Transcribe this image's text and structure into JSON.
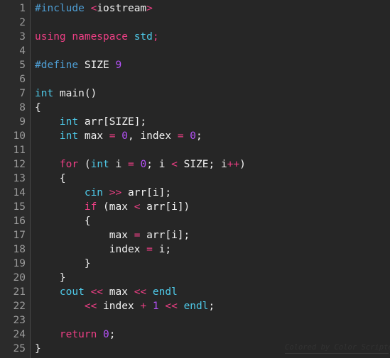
{
  "editor": {
    "language": "C++",
    "background_color": "#262626",
    "gutter_background_color": "#2b2b2b",
    "gutter_divider_color": "#4a4a4a",
    "line_number_color": "#9a9a9a",
    "default_text_color": "#f2f2f2",
    "first_line_number": 1,
    "last_line_number": 25,
    "total_lines": 25
  },
  "palette": {
    "keyword": "#ee3f85",
    "type": "#4ec9e8",
    "preprocessor": "#4e9ed4",
    "builtin": "#4ec9e8",
    "number": "#b451f7",
    "operator": "#ee3f85",
    "plain": "#f2f2f2"
  },
  "gutter": {
    "line_numbers": [
      "1",
      "2",
      "3",
      "4",
      "5",
      "6",
      "7",
      "8",
      "9",
      "10",
      "11",
      "12",
      "13",
      "14",
      "15",
      "16",
      "17",
      "18",
      "19",
      "20",
      "21",
      "22",
      "23",
      "24",
      "25"
    ]
  },
  "code": {
    "plain_text": [
      "#include <iostream>",
      "",
      "using namespace std;",
      "",
      "#define SIZE 9",
      "",
      "int main()",
      "{",
      "    int arr[SIZE];",
      "    int max = 0, index = 0;",
      "",
      "    for (int i = 0; i < SIZE; i++)",
      "    {",
      "        cin >> arr[i];",
      "        if (max < arr[i])",
      "        {",
      "            max = arr[i];",
      "            index = i;",
      "        }",
      "    }",
      "    cout << max << endl",
      "        << index + 1 << endl;",
      "",
      "    return 0;",
      "}"
    ],
    "lines": [
      [
        {
          "t": "#include",
          "c": "pre"
        },
        {
          "t": " ",
          "c": "plain"
        },
        {
          "t": "<",
          "c": "op"
        },
        {
          "t": "iostream",
          "c": "plain"
        },
        {
          "t": ">",
          "c": "op"
        }
      ],
      [],
      [
        {
          "t": "using namespace",
          "c": "keyword"
        },
        {
          "t": " ",
          "c": "plain"
        },
        {
          "t": "std",
          "c": "type"
        },
        {
          "t": ";",
          "c": "op"
        }
      ],
      [],
      [
        {
          "t": "#define",
          "c": "pre"
        },
        {
          "t": " SIZE ",
          "c": "plain"
        },
        {
          "t": "9",
          "c": "number"
        }
      ],
      [],
      [
        {
          "t": "int",
          "c": "type"
        },
        {
          "t": " main()",
          "c": "plain"
        }
      ],
      [
        {
          "t": "{",
          "c": "plain"
        }
      ],
      [
        {
          "t": "    ",
          "c": "plain"
        },
        {
          "t": "int",
          "c": "type"
        },
        {
          "t": " arr[SIZE];",
          "c": "plain"
        }
      ],
      [
        {
          "t": "    ",
          "c": "plain"
        },
        {
          "t": "int",
          "c": "type"
        },
        {
          "t": " max ",
          "c": "plain"
        },
        {
          "t": "=",
          "c": "op"
        },
        {
          "t": " ",
          "c": "plain"
        },
        {
          "t": "0",
          "c": "number"
        },
        {
          "t": ", index ",
          "c": "plain"
        },
        {
          "t": "=",
          "c": "op"
        },
        {
          "t": " ",
          "c": "plain"
        },
        {
          "t": "0",
          "c": "number"
        },
        {
          "t": ";",
          "c": "plain"
        }
      ],
      [],
      [
        {
          "t": "    ",
          "c": "plain"
        },
        {
          "t": "for",
          "c": "keyword"
        },
        {
          "t": " (",
          "c": "plain"
        },
        {
          "t": "int",
          "c": "type"
        },
        {
          "t": " i ",
          "c": "plain"
        },
        {
          "t": "=",
          "c": "op"
        },
        {
          "t": " ",
          "c": "plain"
        },
        {
          "t": "0",
          "c": "number"
        },
        {
          "t": "; i ",
          "c": "plain"
        },
        {
          "t": "<",
          "c": "op"
        },
        {
          "t": " SIZE; i",
          "c": "plain"
        },
        {
          "t": "++",
          "c": "op"
        },
        {
          "t": ")",
          "c": "plain"
        }
      ],
      [
        {
          "t": "    {",
          "c": "plain"
        }
      ],
      [
        {
          "t": "        ",
          "c": "plain"
        },
        {
          "t": "cin",
          "c": "builtin"
        },
        {
          "t": " ",
          "c": "plain"
        },
        {
          "t": ">>",
          "c": "op"
        },
        {
          "t": " arr[i];",
          "c": "plain"
        }
      ],
      [
        {
          "t": "        ",
          "c": "plain"
        },
        {
          "t": "if",
          "c": "keyword"
        },
        {
          "t": " (max ",
          "c": "plain"
        },
        {
          "t": "<",
          "c": "op"
        },
        {
          "t": " arr[i])",
          "c": "plain"
        }
      ],
      [
        {
          "t": "        {",
          "c": "plain"
        }
      ],
      [
        {
          "t": "            max ",
          "c": "plain"
        },
        {
          "t": "=",
          "c": "op"
        },
        {
          "t": " arr[i];",
          "c": "plain"
        }
      ],
      [
        {
          "t": "            index ",
          "c": "plain"
        },
        {
          "t": "=",
          "c": "op"
        },
        {
          "t": " i;",
          "c": "plain"
        }
      ],
      [
        {
          "t": "        }",
          "c": "plain"
        }
      ],
      [
        {
          "t": "    }",
          "c": "plain"
        }
      ],
      [
        {
          "t": "    ",
          "c": "plain"
        },
        {
          "t": "cout",
          "c": "builtin"
        },
        {
          "t": " ",
          "c": "plain"
        },
        {
          "t": "<<",
          "c": "op"
        },
        {
          "t": " max ",
          "c": "plain"
        },
        {
          "t": "<<",
          "c": "op"
        },
        {
          "t": " ",
          "c": "plain"
        },
        {
          "t": "endl",
          "c": "builtin"
        }
      ],
      [
        {
          "t": "        ",
          "c": "plain"
        },
        {
          "t": "<<",
          "c": "op"
        },
        {
          "t": " index ",
          "c": "plain"
        },
        {
          "t": "+",
          "c": "op"
        },
        {
          "t": " ",
          "c": "plain"
        },
        {
          "t": "1",
          "c": "number"
        },
        {
          "t": " ",
          "c": "plain"
        },
        {
          "t": "<<",
          "c": "op"
        },
        {
          "t": " ",
          "c": "plain"
        },
        {
          "t": "endl",
          "c": "builtin"
        },
        {
          "t": ";",
          "c": "plain"
        }
      ],
      [],
      [
        {
          "t": "    ",
          "c": "plain"
        },
        {
          "t": "return",
          "c": "keyword"
        },
        {
          "t": " ",
          "c": "plain"
        },
        {
          "t": "0",
          "c": "number"
        },
        {
          "t": ";",
          "c": "plain"
        }
      ],
      [
        {
          "t": "}",
          "c": "plain"
        }
      ]
    ]
  },
  "watermark": {
    "text": "Colored by Color Scripter"
  }
}
